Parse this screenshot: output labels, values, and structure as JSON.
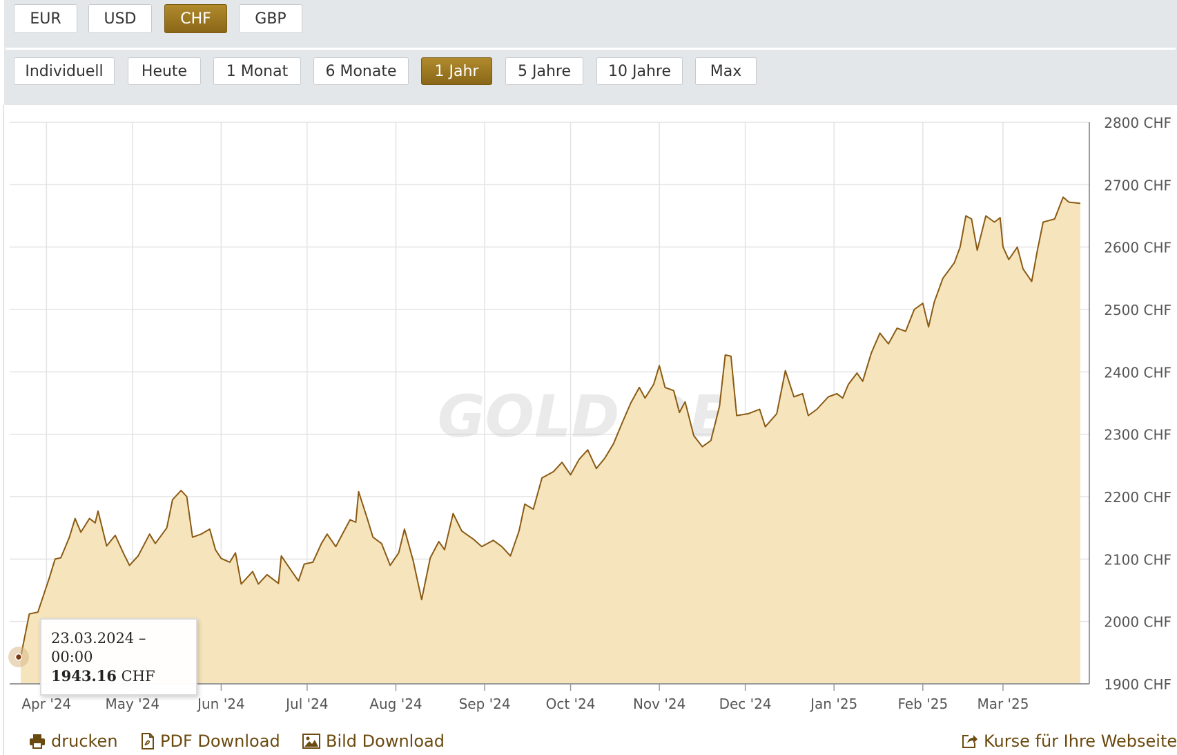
{
  "currency_buttons": [
    {
      "label": "EUR",
      "active": false
    },
    {
      "label": "USD",
      "active": false
    },
    {
      "label": "CHF",
      "active": true
    },
    {
      "label": "GBP",
      "active": false
    }
  ],
  "range_buttons": [
    {
      "label": "Individuell",
      "active": false
    },
    {
      "label": "Heute",
      "active": false
    },
    {
      "label": "1 Monat",
      "active": false
    },
    {
      "label": "6 Monate",
      "active": false
    },
    {
      "label": "1 Jahr",
      "active": true
    },
    {
      "label": "5 Jahre",
      "active": false
    },
    {
      "label": "10 Jahre",
      "active": false
    },
    {
      "label": "Max",
      "active": false
    }
  ],
  "watermark": "GOLD.DE",
  "tooltip": {
    "date": "23.03.2024 – 00:00",
    "value": "1943.16",
    "unit": "CHF"
  },
  "footer": {
    "print": "drucken",
    "pdf": "PDF Download",
    "image": "Bild Download",
    "embed": "Kurse für Ihre Webseite"
  },
  "colors": {
    "accent": "#9c7a24",
    "line": "#8a5a14",
    "area": "#f5e4bc",
    "grid": "#e3e3e3"
  },
  "chart_data": {
    "type": "area",
    "title": "",
    "xlabel": "",
    "ylabel": "",
    "unit": "CHF",
    "ylim": [
      1900,
      2800
    ],
    "xlim": [
      "2024-03-23",
      "2025-03-28"
    ],
    "grid": true,
    "y_ticks": [
      1900,
      2000,
      2100,
      2200,
      2300,
      2400,
      2500,
      2600,
      2700,
      2800
    ],
    "y_tick_labels": [
      "1900 CHF",
      "2000 CHF",
      "2100 CHF",
      "2200 CHF",
      "2300 CHF",
      "2400 CHF",
      "2500 CHF",
      "2600 CHF",
      "2700 CHF",
      "2800 CHF"
    ],
    "x_ticks": [
      "2024-04-01",
      "2024-05-01",
      "2024-06-01",
      "2024-07-01",
      "2024-08-01",
      "2024-09-01",
      "2024-10-01",
      "2024-11-01",
      "2024-12-01",
      "2025-01-01",
      "2025-02-01",
      "2025-03-01"
    ],
    "x_tick_labels": [
      "Apr '24",
      "May '24",
      "Jun '24",
      "Jul '24",
      "Aug '24",
      "Sep '24",
      "Oct '24",
      "Nov '24",
      "Dec '24",
      "Jan '25",
      "Feb '25",
      "Mar '25"
    ],
    "series": [
      {
        "points": [
          [
            "2024-03-23",
            1943
          ],
          [
            "2024-03-26",
            2012
          ],
          [
            "2024-03-29",
            2015
          ],
          [
            "2024-04-02",
            2070
          ],
          [
            "2024-04-04",
            2100
          ],
          [
            "2024-04-06",
            2102
          ],
          [
            "2024-04-09",
            2135
          ],
          [
            "2024-04-11",
            2165
          ],
          [
            "2024-04-13",
            2143
          ],
          [
            "2024-04-16",
            2165
          ],
          [
            "2024-04-18",
            2158
          ],
          [
            "2024-04-19",
            2177
          ],
          [
            "2024-04-22",
            2121
          ],
          [
            "2024-04-25",
            2138
          ],
          [
            "2024-04-28",
            2108
          ],
          [
            "2024-04-30",
            2090
          ],
          [
            "2024-05-03",
            2105
          ],
          [
            "2024-05-07",
            2140
          ],
          [
            "2024-05-09",
            2125
          ],
          [
            "2024-05-13",
            2150
          ],
          [
            "2024-05-15",
            2195
          ],
          [
            "2024-05-18",
            2210
          ],
          [
            "2024-05-20",
            2200
          ],
          [
            "2024-05-22",
            2135
          ],
          [
            "2024-05-25",
            2140
          ],
          [
            "2024-05-28",
            2148
          ],
          [
            "2024-05-30",
            2115
          ],
          [
            "2024-06-01",
            2101
          ],
          [
            "2024-06-04",
            2095
          ],
          [
            "2024-06-06",
            2110
          ],
          [
            "2024-06-08",
            2060
          ],
          [
            "2024-06-12",
            2080
          ],
          [
            "2024-06-14",
            2060
          ],
          [
            "2024-06-17",
            2075
          ],
          [
            "2024-06-21",
            2061
          ],
          [
            "2024-06-22",
            2105
          ],
          [
            "2024-06-26",
            2078
          ],
          [
            "2024-06-28",
            2065
          ],
          [
            "2024-06-30",
            2092
          ],
          [
            "2024-07-03",
            2095
          ],
          [
            "2024-07-06",
            2125
          ],
          [
            "2024-07-08",
            2140
          ],
          [
            "2024-07-11",
            2120
          ],
          [
            "2024-07-13",
            2137
          ],
          [
            "2024-07-16",
            2163
          ],
          [
            "2024-07-18",
            2159
          ],
          [
            "2024-07-19",
            2208
          ],
          [
            "2024-07-22",
            2165
          ],
          [
            "2024-07-24",
            2135
          ],
          [
            "2024-07-27",
            2125
          ],
          [
            "2024-07-30",
            2090
          ],
          [
            "2024-08-02",
            2110
          ],
          [
            "2024-08-04",
            2148
          ],
          [
            "2024-08-07",
            2098
          ],
          [
            "2024-08-10",
            2035
          ],
          [
            "2024-08-13",
            2102
          ],
          [
            "2024-08-16",
            2128
          ],
          [
            "2024-08-18",
            2115
          ],
          [
            "2024-08-21",
            2173
          ],
          [
            "2024-08-24",
            2145
          ],
          [
            "2024-08-28",
            2132
          ],
          [
            "2024-08-31",
            2120
          ],
          [
            "2024-09-04",
            2130
          ],
          [
            "2024-09-07",
            2120
          ],
          [
            "2024-09-10",
            2105
          ],
          [
            "2024-09-13",
            2145
          ],
          [
            "2024-09-15",
            2188
          ],
          [
            "2024-09-18",
            2180
          ],
          [
            "2024-09-21",
            2230
          ],
          [
            "2024-09-25",
            2240
          ],
          [
            "2024-09-28",
            2255
          ],
          [
            "2024-10-01",
            2235
          ],
          [
            "2024-10-04",
            2260
          ],
          [
            "2024-10-07",
            2275
          ],
          [
            "2024-10-10",
            2245
          ],
          [
            "2024-10-13",
            2262
          ],
          [
            "2024-10-16",
            2285
          ],
          [
            "2024-10-19",
            2318
          ],
          [
            "2024-10-22",
            2350
          ],
          [
            "2024-10-25",
            2375
          ],
          [
            "2024-10-27",
            2358
          ],
          [
            "2024-10-30",
            2380
          ],
          [
            "2024-11-01",
            2410
          ],
          [
            "2024-11-03",
            2375
          ],
          [
            "2024-11-06",
            2370
          ],
          [
            "2024-11-08",
            2335
          ],
          [
            "2024-11-10",
            2352
          ],
          [
            "2024-11-13",
            2298
          ],
          [
            "2024-11-16",
            2280
          ],
          [
            "2024-11-19",
            2290
          ],
          [
            "2024-11-22",
            2345
          ],
          [
            "2024-11-24",
            2427
          ],
          [
            "2024-11-26",
            2425
          ],
          [
            "2024-11-28",
            2330
          ],
          [
            "2024-12-02",
            2333
          ],
          [
            "2024-12-06",
            2340
          ],
          [
            "2024-12-08",
            2312
          ],
          [
            "2024-12-12",
            2333
          ],
          [
            "2024-12-15",
            2402
          ],
          [
            "2024-12-18",
            2360
          ],
          [
            "2024-12-21",
            2365
          ],
          [
            "2024-12-23",
            2330
          ],
          [
            "2024-12-26",
            2340
          ],
          [
            "2024-12-30",
            2360
          ],
          [
            "2025-01-02",
            2365
          ],
          [
            "2025-01-04",
            2358
          ],
          [
            "2025-01-06",
            2380
          ],
          [
            "2025-01-09",
            2398
          ],
          [
            "2025-01-11",
            2385
          ],
          [
            "2025-01-14",
            2430
          ],
          [
            "2025-01-17",
            2462
          ],
          [
            "2025-01-20",
            2445
          ],
          [
            "2025-01-23",
            2470
          ],
          [
            "2025-01-26",
            2465
          ],
          [
            "2025-01-29",
            2500
          ],
          [
            "2025-02-01",
            2510
          ],
          [
            "2025-02-03",
            2472
          ],
          [
            "2025-02-05",
            2512
          ],
          [
            "2025-02-08",
            2550
          ],
          [
            "2025-02-12",
            2575
          ],
          [
            "2025-02-14",
            2600
          ],
          [
            "2025-02-16",
            2650
          ],
          [
            "2025-02-18",
            2645
          ],
          [
            "2025-02-20",
            2595
          ],
          [
            "2025-02-23",
            2650
          ],
          [
            "2025-02-26",
            2640
          ],
          [
            "2025-02-28",
            2647
          ],
          [
            "2025-03-01",
            2600
          ],
          [
            "2025-03-03",
            2580
          ],
          [
            "2025-03-06",
            2600
          ],
          [
            "2025-03-08",
            2565
          ],
          [
            "2025-03-11",
            2545
          ],
          [
            "2025-03-13",
            2595
          ],
          [
            "2025-03-15",
            2640
          ],
          [
            "2025-03-19",
            2645
          ],
          [
            "2025-03-22",
            2680
          ],
          [
            "2025-03-24",
            2672
          ],
          [
            "2025-03-28",
            2670
          ]
        ]
      }
    ]
  }
}
